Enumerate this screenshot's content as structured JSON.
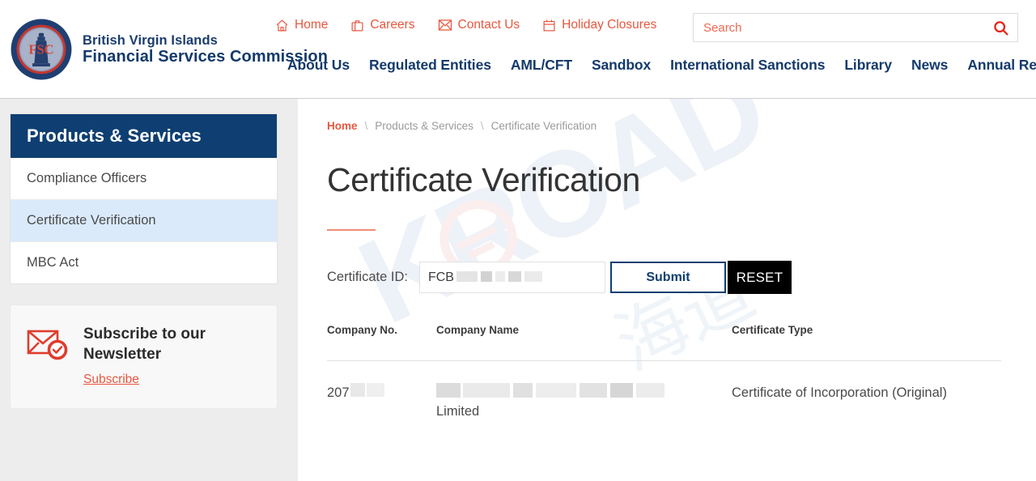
{
  "header": {
    "brand": {
      "line1": "British Virgin Islands",
      "line2": "Financial Services Commission",
      "seal_text": "FSC"
    },
    "utility_nav": [
      {
        "label": "Home",
        "icon": "home-icon"
      },
      {
        "label": "Careers",
        "icon": "briefcase-icon"
      },
      {
        "label": "Contact Us",
        "icon": "envelope-icon"
      },
      {
        "label": "Holiday Closures",
        "icon": "calendar-icon"
      }
    ],
    "search": {
      "placeholder": "Search",
      "value": "",
      "icon": "search-icon"
    },
    "main_nav": [
      "About Us",
      "Regulated Entities",
      "AML/CFT",
      "Sandbox",
      "International Sanctions",
      "Library",
      "News",
      "Annual Returns"
    ]
  },
  "sidebar": {
    "heading": "Products & Services",
    "items": [
      {
        "label": "Compliance Officers",
        "active": false
      },
      {
        "label": "Certificate Verification",
        "active": true
      },
      {
        "label": "MBC Act",
        "active": false
      }
    ],
    "newsletter": {
      "icon": "envelope-check-icon",
      "title": "Subscribe to our Newsletter",
      "link_label": "Subscribe"
    }
  },
  "main": {
    "breadcrumb": {
      "home": "Home",
      "separator": "\\",
      "parent": "Products & Services",
      "current": "Certificate Verification"
    },
    "title": "Certificate Verification",
    "form": {
      "label": "Certificate ID:",
      "input_value": "FCB",
      "input_placeholder": "",
      "input_redacted": true,
      "submit_label": "Submit",
      "reset_label": "RESET"
    },
    "table": {
      "columns": [
        "Company No.",
        "Company Name",
        "Certificate Type"
      ],
      "rows": [
        {
          "company_no": "207",
          "company_no_redacted": true,
          "company_name_redacted": true,
          "company_name_suffix": "Limited",
          "certificate_type": "Certificate of Incorporation (Original)"
        }
      ]
    },
    "watermark": {
      "text": "KROAD",
      "cjk": "海道"
    }
  },
  "colors": {
    "navy": "#0f3f72",
    "accent_red": "#e8573f",
    "active_row": "#dbeafb",
    "rule": "#ef8d78",
    "black_button": "#000000"
  }
}
